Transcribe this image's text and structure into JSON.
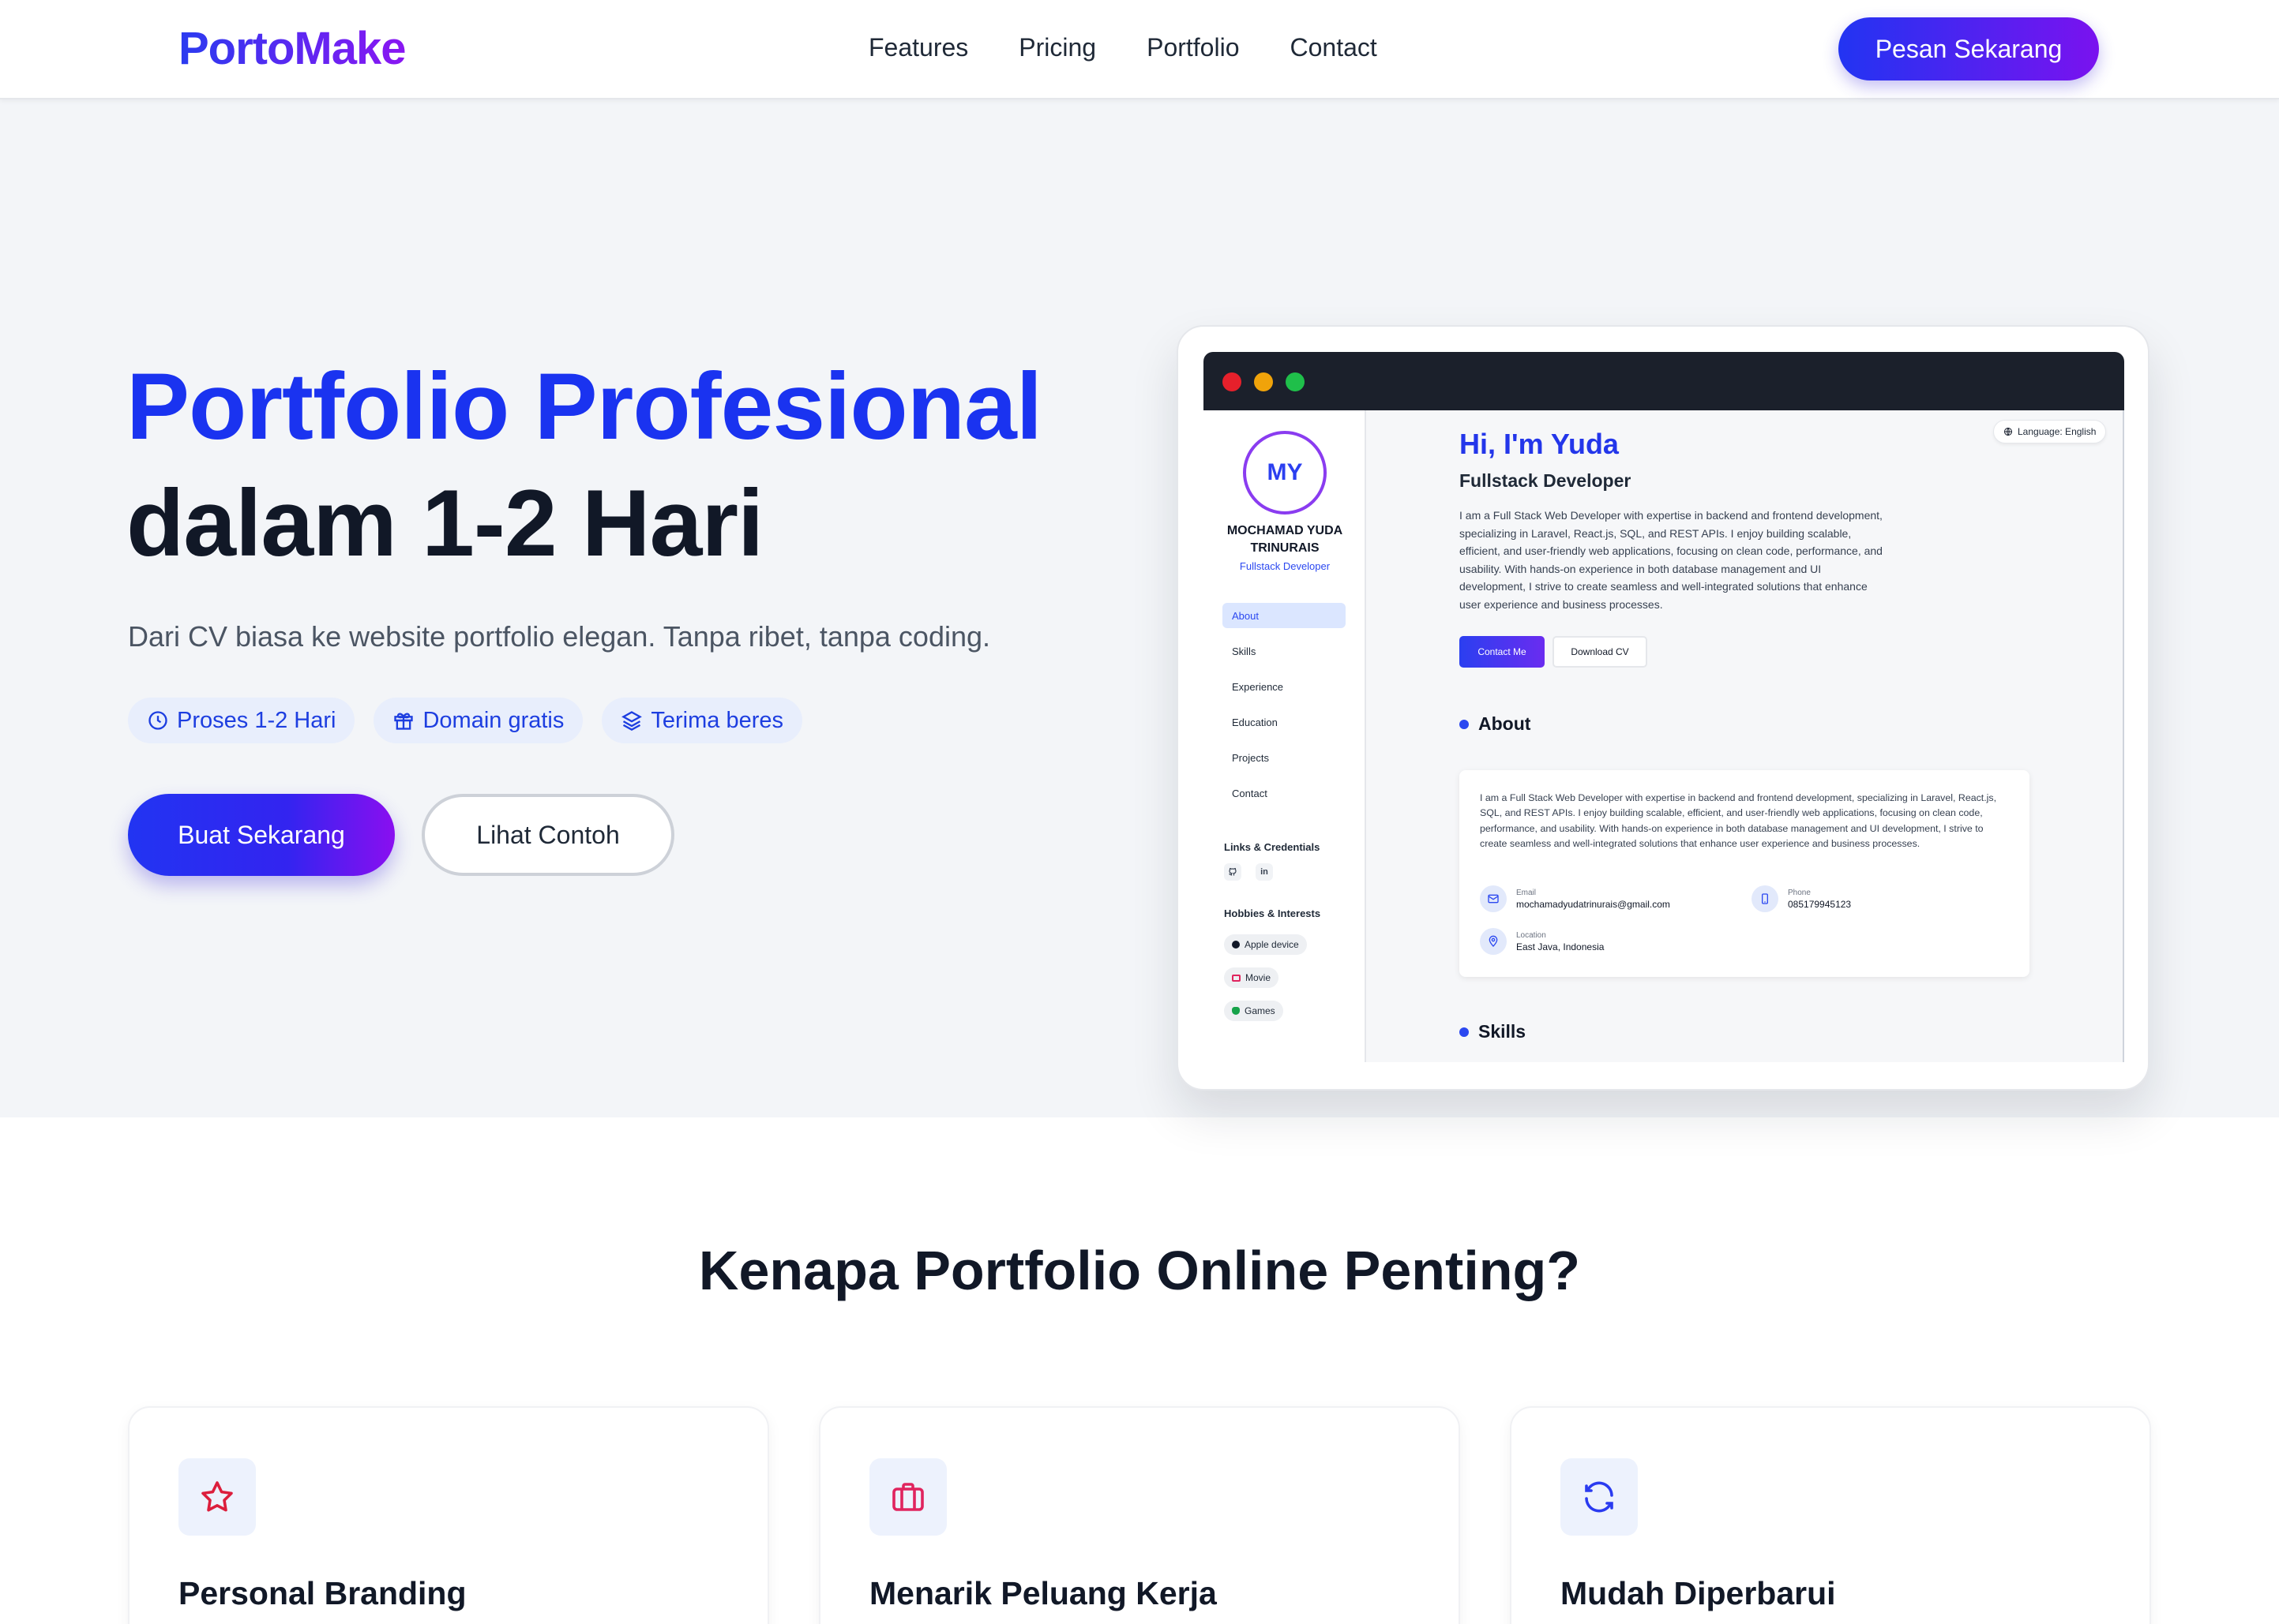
{
  "nav": {
    "logo": "PortoMake",
    "links": [
      "Features",
      "Pricing",
      "Portfolio",
      "Contact"
    ],
    "cta": "Pesan Sekarang"
  },
  "hero": {
    "title_line1": "Portfolio Profesional",
    "title_line2": "dalam 1-2 Hari",
    "subtitle": "Dari CV biasa ke website portfolio elegan. Tanpa ribet, tanpa coding.",
    "badges": [
      {
        "icon": "clock-icon",
        "label": "Proses 1-2 Hari"
      },
      {
        "icon": "gift-icon",
        "label": "Domain gratis"
      },
      {
        "icon": "layers-icon",
        "label": "Terima beres"
      }
    ],
    "primary_button": "Buat Sekarang",
    "secondary_button": "Lihat Contoh"
  },
  "mockup": {
    "avatar_initials": "MY",
    "profile_name_line1": "MOCHAMAD YUDA",
    "profile_name_line2": "TRINURAIS",
    "profile_role": "Fullstack Developer",
    "menu": [
      "About",
      "Skills",
      "Experience",
      "Education",
      "Projects",
      "Contact"
    ],
    "active_menu": "About",
    "links_heading": "Links & Credentials",
    "link_icons": [
      "github-icon",
      "linkedin-icon"
    ],
    "linkedin_label": "in",
    "hobbies_heading": "Hobbies & Interests",
    "hobbies": [
      "Apple device",
      "Movie",
      "Games"
    ],
    "language": "Language: English",
    "greeting": "Hi, I'm Yuda",
    "role": "Fullstack Developer",
    "description": "I am a Full Stack Web Developer with expertise in backend and frontend development, specializing in Laravel, React.js, SQL, and REST APIs. I enjoy building scalable, efficient, and user-friendly web applications, focusing on clean code, performance, and usability. With hands-on experience in both database management and UI development, I strive to create seamless and well-integrated solutions that enhance user experience and business processes.",
    "contact_button": "Contact Me",
    "download_button": "Download CV",
    "about_heading": "About",
    "about_text": "I am a Full Stack Web Developer with expertise in backend and frontend development, specializing in Laravel, React.js, SQL, and REST APIs. I enjoy building scalable, efficient, and user-friendly web applications, focusing on clean code, performance, and usability. With hands-on experience in both database management and UI development, I strive to create seamless and well-integrated solutions that enhance user experience and business processes.",
    "email_label": "Email",
    "email_value": "mochamadyudatrinurais@gmail.com",
    "phone_label": "Phone",
    "phone_value": "085179945123",
    "location_label": "Location",
    "location_value": "East Java, Indonesia",
    "skills_heading": "Skills"
  },
  "features": {
    "title": "Kenapa Portfolio Online Penting?",
    "cards": [
      {
        "icon": "star-icon",
        "title": "Personal Branding"
      },
      {
        "icon": "briefcase-icon",
        "title": "Menarik Peluang Kerja"
      },
      {
        "icon": "refresh-icon",
        "title": "Mudah Diperbarui"
      }
    ]
  },
  "colors": {
    "primary": "#1a33f0",
    "gradient_end": "#8a16f2",
    "hero_bg": "#f3f5f8",
    "star_icon": "#dc1e3c",
    "briefcase_icon": "#e0245e",
    "refresh_icon": "#2a3bf0"
  }
}
